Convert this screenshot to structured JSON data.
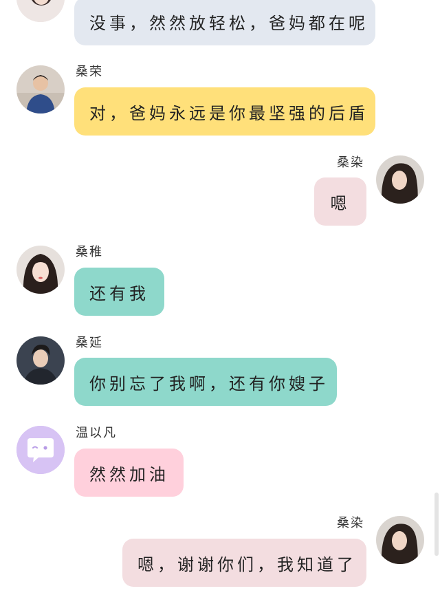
{
  "messages": [
    {
      "sender": "",
      "text": "没事，然然放轻松，爸妈都在呢",
      "side": "left",
      "bubble_color": "#e3e8f0"
    },
    {
      "sender": "桑荣",
      "text": "对，爸妈永远是你最坚强的后盾",
      "side": "left",
      "bubble_color": "#ffe07a"
    },
    {
      "sender": "桑染",
      "text": "嗯",
      "side": "right",
      "bubble_color": "#f3dde0"
    },
    {
      "sender": "桑稚",
      "text": "还有我",
      "side": "left",
      "bubble_color": "#8ed8cb"
    },
    {
      "sender": "桑延",
      "text": "你别忘了我啊，还有你嫂子",
      "side": "left",
      "bubble_color": "#8ed8cb"
    },
    {
      "sender": "温以凡",
      "text": "然然加油",
      "side": "left",
      "bubble_color": "#ffd0dc"
    },
    {
      "sender": "桑染",
      "text": "嗯，谢谢你们，我知道了",
      "side": "right",
      "bubble_color": "#f3dde0"
    }
  ]
}
